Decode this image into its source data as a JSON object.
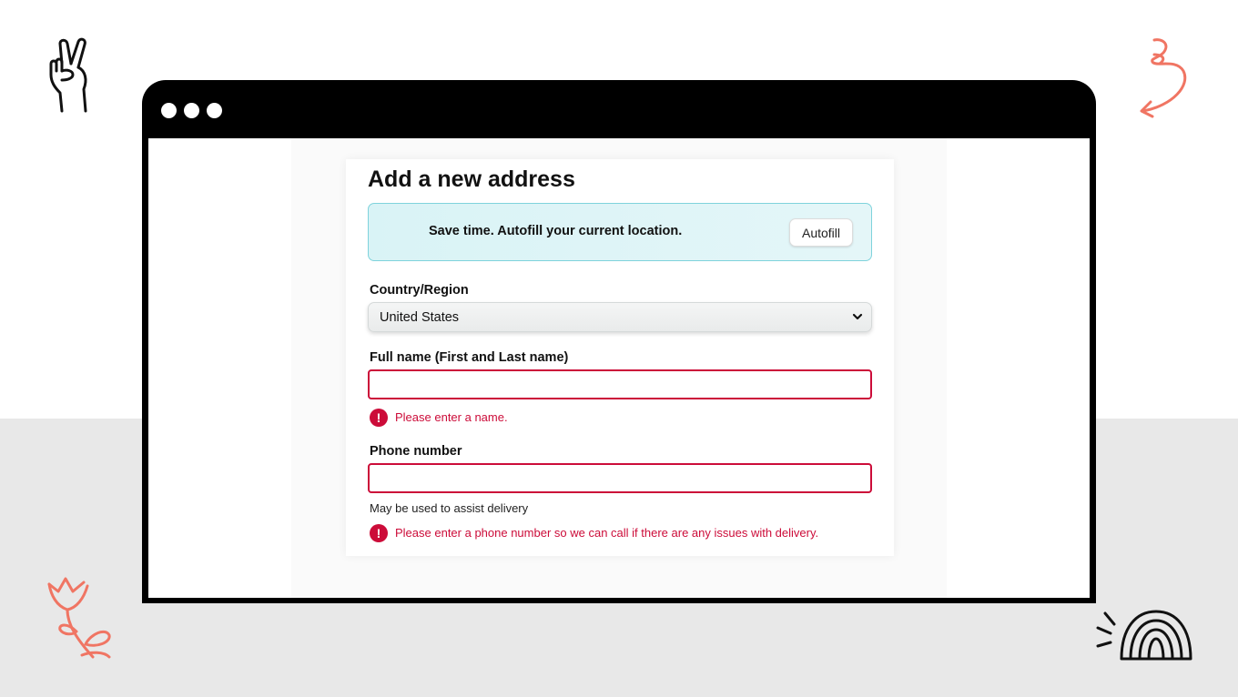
{
  "browser": {
    "window_dots": 3
  },
  "form": {
    "title": "Add a new address",
    "autofill": {
      "message": "Save time. Autofill your current location.",
      "button_label": "Autofill"
    },
    "country": {
      "label": "Country/Region",
      "value": "United States"
    },
    "full_name": {
      "label": "Full name (First and Last name)",
      "value": "",
      "error": "Please enter a name."
    },
    "phone": {
      "label": "Phone number",
      "value": "",
      "hint": "May be used to assist delivery",
      "error": "Please enter a phone number so we can call if there are any issues with delivery."
    }
  },
  "colors": {
    "error": "#cc0c39",
    "banner_border": "#7fd3dc",
    "banner_background": "#dff4f7",
    "doodle_accent": "#f07563"
  },
  "decorations": [
    "peace-hand-icon",
    "spiral-arrow-icon",
    "tulip-icon",
    "rainbow-icon"
  ]
}
